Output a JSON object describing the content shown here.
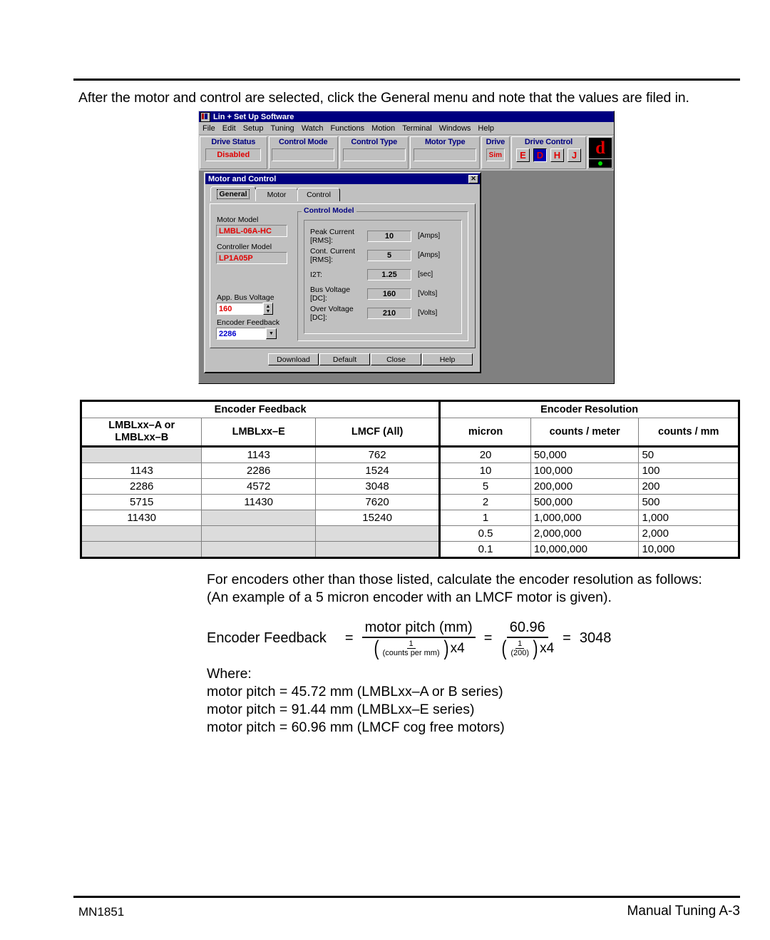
{
  "page": {
    "intro": "After the motor and control are selected, click the General menu and note that the values are filed in.",
    "footer_left": "MN1851",
    "footer_right": "Manual Tuning  A-3"
  },
  "screenshot": {
    "window_title": "Lin + Set Up Software",
    "menu": [
      "File",
      "Edit",
      "Setup",
      "Tuning",
      "Watch",
      "Functions",
      "Motion",
      "Terminal",
      "Windows",
      "Help"
    ],
    "toolbar": {
      "drive_status_label": "Drive Status",
      "drive_status_value": "Disabled",
      "control_mode_label": "Control Mode",
      "control_mode_value": "",
      "control_type_label": "Control Type",
      "control_type_value": "",
      "motor_type_label": "Motor Type",
      "motor_type_value": "",
      "drive_label": "Drive",
      "drive_value": "Sim",
      "drive_control_label": "Drive Control",
      "drive_control_buttons": [
        "E",
        "D",
        "H",
        "J"
      ],
      "drive_control_active": "D",
      "led_char": "d",
      "accent_blue": "#000080",
      "accent_red": "#e00000",
      "led_green": "#00dd00"
    },
    "dialog": {
      "title": "Motor and Control",
      "close_label": "✕",
      "tabs": [
        "General",
        "Motor",
        "Control"
      ],
      "active_tab": "General",
      "motor_model_label": "Motor Model",
      "motor_model_value": "LMBL-06A-HC",
      "controller_model_label": "Controller Model",
      "controller_model_value": "LP1A05P",
      "bus_voltage_label": "App. Bus Voltage",
      "bus_voltage_value": "160",
      "encoder_feedback_label": "Encoder Feedback",
      "encoder_feedback_value": "2286",
      "group_title": "Control Model",
      "rows": [
        {
          "label": "Peak Current [RMS]:",
          "value": "10",
          "unit": "[Amps]"
        },
        {
          "label": "Cont. Current [RMS]:",
          "value": "5",
          "unit": "[Amps]"
        },
        {
          "label": "I2T:",
          "value": "1.25",
          "unit": "[sec]"
        },
        {
          "label": "Bus Voltage [DC]:",
          "value": "160",
          "unit": "[Volts]"
        },
        {
          "label": "Over Voltage [DC]:",
          "value": "210",
          "unit": "[Volts]"
        }
      ],
      "buttons": [
        "Download",
        "Default",
        "Close",
        "Help"
      ]
    }
  },
  "table": {
    "group_headers": [
      "Encoder Feedback",
      "Encoder Resolution"
    ],
    "columns": [
      "LMBLxx–A or\nLMBLxx–B",
      "LMBLxx–E",
      "LMCF (All)",
      "micron",
      "counts / meter",
      "counts / mm"
    ],
    "col0_line1": "LMBLxx–A or",
    "col0_line2": "LMBLxx–B",
    "col1": "LMBLxx–E",
    "col2": "LMCF (All)",
    "col3": "micron",
    "col4": "counts / meter",
    "col5": "counts / mm",
    "rows": [
      {
        "a_or_b": "",
        "e": "1143",
        "lmcf": "762",
        "micron": "20",
        "counts_meter": "50,000",
        "counts_mm": "50"
      },
      {
        "a_or_b": "1143",
        "e": "2286",
        "lmcf": "1524",
        "micron": "10",
        "counts_meter": "100,000",
        "counts_mm": "100"
      },
      {
        "a_or_b": "2286",
        "e": "4572",
        "lmcf": "3048",
        "micron": "5",
        "counts_meter": "200,000",
        "counts_mm": "200"
      },
      {
        "a_or_b": "5715",
        "e": "11430",
        "lmcf": "7620",
        "micron": "2",
        "counts_meter": "500,000",
        "counts_mm": "500"
      },
      {
        "a_or_b": "11430",
        "e": "",
        "lmcf": "15240",
        "micron": "1",
        "counts_meter": "1,000,000",
        "counts_mm": "1,000"
      },
      {
        "a_or_b": "",
        "e": "",
        "lmcf": "",
        "micron": "0.5",
        "counts_meter": "2,000,000",
        "counts_mm": "2,000"
      },
      {
        "a_or_b": "",
        "e": "",
        "lmcf": "",
        "micron": "0.1",
        "counts_meter": "10,000,000",
        "counts_mm": "10,000"
      }
    ]
  },
  "body": {
    "para_line1": "For encoders other than those listed, calculate the encoder resolution as follows:",
    "para_line2": "(An example of a 5 micron encoder with an LMCF motor is given).",
    "where_label": "Where:",
    "where_lines": [
      "motor pitch = 45.72 mm (LMBLxx–A or B series)",
      "motor pitch = 91.44 mm (LMBLxx–E series)",
      "motor pitch = 60.96 mm (LMCF cog free motors)"
    ]
  },
  "formula": {
    "lhs": "Encoder Feedback",
    "eq1": "=",
    "num1": "motor pitch (mm)",
    "den1_one": "1",
    "den1_base": "(counts per mm)",
    "den1_mult": "x4",
    "eq2": "=",
    "num2": "60.96",
    "den2_one": "1",
    "den2_base": "(200)",
    "den2_mult": "x4",
    "eq3": "=",
    "result": "3048"
  }
}
